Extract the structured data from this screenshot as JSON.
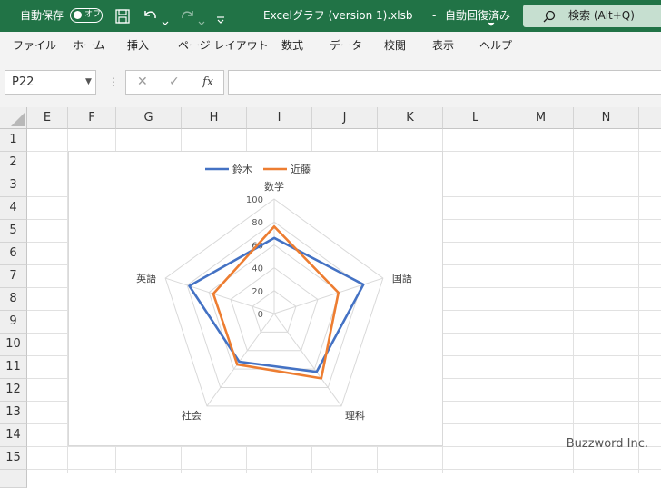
{
  "titlebar": {
    "autosave_label": "自動保存",
    "autosave_state": "オフ",
    "filename": "Excelグラフ (version 1).xlsb",
    "separator": "-",
    "save_status": "自動回復済み",
    "search_label": "検索 (Alt+Q)"
  },
  "ribbon": {
    "tabs": [
      "ファイル",
      "ホーム",
      "挿入",
      "ページ レイアウト",
      "数式",
      "データ",
      "校閲",
      "表示",
      "ヘルプ"
    ]
  },
  "formula_bar": {
    "name_box": "P22",
    "fx_label": "fx",
    "formula": ""
  },
  "grid": {
    "columns": [
      "E",
      "F",
      "G",
      "H",
      "I",
      "J",
      "K",
      "L",
      "M",
      "N"
    ],
    "rows": [
      "1",
      "2",
      "3",
      "4",
      "5",
      "6",
      "7",
      "8",
      "9",
      "10",
      "11",
      "12",
      "13",
      "14",
      "15"
    ]
  },
  "chart_data": {
    "type": "radar",
    "categories": [
      "数学",
      "国語",
      "理科",
      "社会",
      "英語"
    ],
    "series": [
      {
        "name": "鈴木",
        "values": [
          66,
          82,
          63,
          52,
          78
        ],
        "color": "#4472c4"
      },
      {
        "name": "近藤",
        "values": [
          76,
          59,
          70,
          55,
          56
        ],
        "color": "#ed7d31"
      }
    ],
    "ticks": [
      0,
      20,
      40,
      60,
      80,
      100
    ],
    "ylim": [
      0,
      100
    ],
    "legend_position": "top"
  },
  "watermark": "Buzzword Inc.",
  "colors": {
    "excel_green": "#217346"
  }
}
